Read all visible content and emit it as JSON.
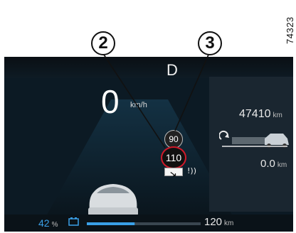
{
  "reference": {
    "code": "74323"
  },
  "callouts": {
    "c2": "2",
    "c3": "3"
  },
  "display": {
    "gear": "D",
    "speed": "0",
    "speed_unit": "km/h",
    "odometer": {
      "value": "47410",
      "unit": "km"
    },
    "trip": {
      "value": "0.0",
      "unit": "km"
    },
    "speed_limit_secondary": "90",
    "speed_limit_primary": "110",
    "battery_percent": {
      "value": "42",
      "unit": "%"
    },
    "range": {
      "value": "120",
      "unit": "km"
    },
    "battery_level": 0.42,
    "icons": {
      "trip_reset": "trip-reset-icon",
      "vehicle_side": "vehicle-side-icon",
      "vehicle_rear": "vehicle-rear-icon",
      "alert": "alert-icon",
      "battery": "battery-icon",
      "sub_panel": "sub-panel-icon"
    },
    "colors": {
      "background": "#0c1a24",
      "accent_blue": "#3aa0e8",
      "limit_red": "#d11a2a"
    }
  }
}
